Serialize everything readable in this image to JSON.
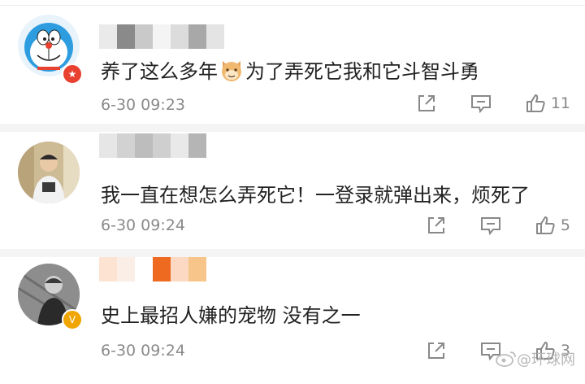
{
  "comments": [
    {
      "text_before": "养了这么多年",
      "text_after": "为了弄死它我和它斗智斗勇",
      "time": "6-30 09:23",
      "likes": "11"
    },
    {
      "text": "我一直在想怎么弄死它！一登录就弹出来，烦死了",
      "time": "6-30 09:24",
      "likes": "5"
    },
    {
      "text": "史上最招人嫌的宠物 没有之一",
      "time": "6-30 09:24",
      "likes": "3"
    }
  ],
  "watermark": {
    "text": "@环球网"
  },
  "colors": {
    "text": "#222222",
    "meta": "#8a8a8a",
    "badge_red": "#e8412f",
    "badge_gold": "#f0a500"
  },
  "icons": {
    "repost": "share-square-icon",
    "comment": "comment-bubble-icon",
    "like": "thumbs-up-icon",
    "watermark": "weibo-icon"
  }
}
